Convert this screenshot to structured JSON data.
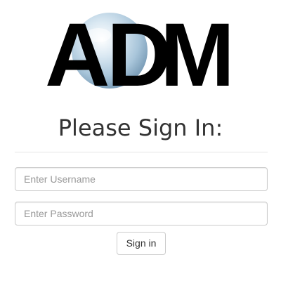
{
  "logo": {
    "text": "ADM",
    "letters": [
      "A",
      "D",
      "M"
    ],
    "text_color": "#000000",
    "orb_color": "#a9c8dc"
  },
  "form": {
    "title": "Please Sign In:",
    "username_placeholder": "Enter Username",
    "password_placeholder": "Enter Password",
    "submit_label": "Sign in"
  },
  "colors": {
    "text": "#333333",
    "border": "#cccccc",
    "placeholder": "#999999",
    "divider": "#e5e5e5"
  }
}
